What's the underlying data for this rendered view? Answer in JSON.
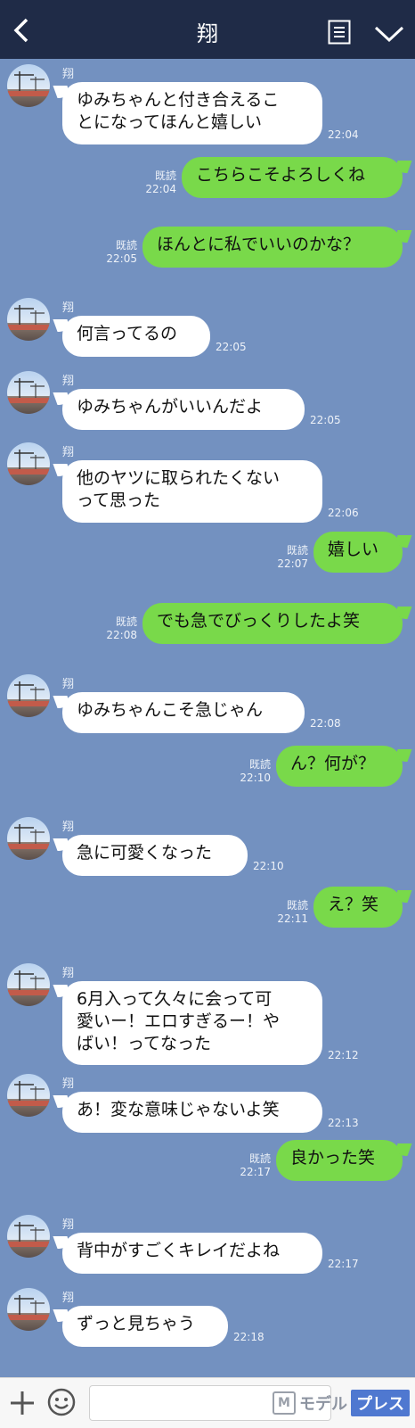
{
  "header": {
    "title": "翔"
  },
  "sender_name": "翔",
  "read_label": "既読",
  "messages": [
    {
      "dir": "in",
      "lines": [
        "ゆみちゃんと付き合えるこ",
        "とになってほんと嬉しい"
      ],
      "time": "22:04"
    },
    {
      "dir": "out",
      "lines": [
        "こちらこそよろしくね"
      ],
      "time": "22:04",
      "read": "既読"
    },
    {
      "dir": "out",
      "lines": [
        "ほんとに私でいいのかな？"
      ],
      "time": "22:05",
      "read": "既読"
    },
    {
      "dir": "in",
      "lines": [
        "何言ってるの"
      ],
      "time": "22:05"
    },
    {
      "dir": "in",
      "lines": [
        "ゆみちゃんがいいんだよ"
      ],
      "time": "22:05"
    },
    {
      "dir": "in",
      "lines": [
        "他のヤツに取られたくない",
        "って思った"
      ],
      "time": "22:06"
    },
    {
      "dir": "out",
      "lines": [
        "嬉しい"
      ],
      "time": "22:07",
      "read": "既読"
    },
    {
      "dir": "out",
      "lines": [
        "でも急でびっくりしたよ笑"
      ],
      "time": "22:08",
      "read": "既読"
    },
    {
      "dir": "in",
      "lines": [
        "ゆみちゃんこそ急じゃん"
      ],
      "time": "22:08"
    },
    {
      "dir": "out",
      "lines": [
        "ん？何が？"
      ],
      "time": "22:10",
      "read": "既読"
    },
    {
      "dir": "in",
      "lines": [
        "急に可愛くなった"
      ],
      "time": "22:10"
    },
    {
      "dir": "out",
      "lines": [
        "え？笑"
      ],
      "time": "22:11",
      "read": "既読"
    },
    {
      "dir": "in",
      "lines": [
        "6月入って久々に会って可",
        "愛いー！エロすぎるー！や",
        "ばい！ってなった"
      ],
      "time": "22:12"
    },
    {
      "dir": "in",
      "lines": [
        "あ！変な意味じゃないよ笑"
      ],
      "time": "22:13"
    },
    {
      "dir": "out",
      "lines": [
        "良かった笑"
      ],
      "time": "22:17",
      "read": "既読"
    },
    {
      "dir": "in",
      "lines": [
        "背中がすごくキレイだよね"
      ],
      "time": "22:17"
    },
    {
      "dir": "in",
      "lines": [
        "ずっと見ちゃう"
      ],
      "time": "22:18"
    }
  ],
  "footer": {
    "brand_prefix": "モデル",
    "brand_suffix": "プレス",
    "brand_mark": "M"
  },
  "colors": {
    "background": "#7391c0",
    "header": "#1f2b47",
    "outgoing_bubble": "#79d94a",
    "incoming_bubble": "#ffffff"
  }
}
